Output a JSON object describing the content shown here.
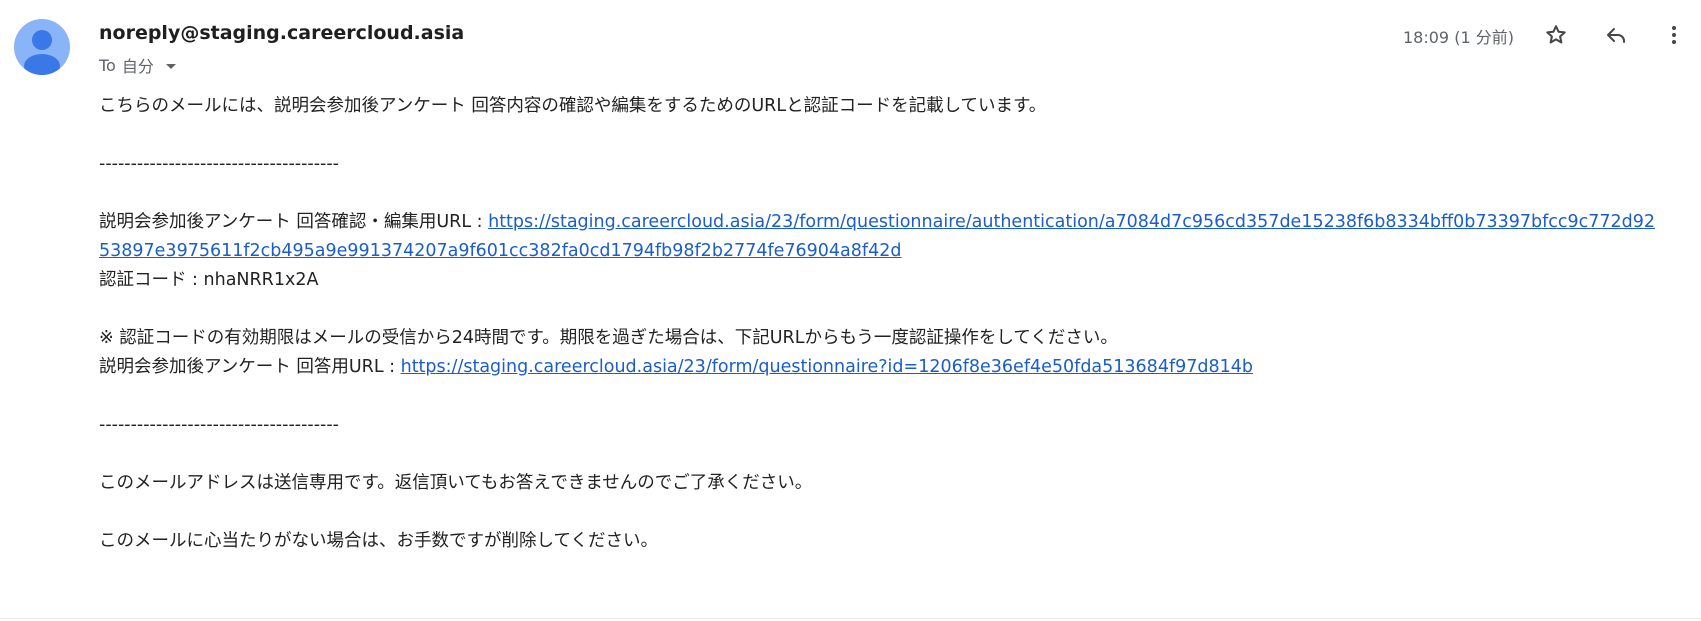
{
  "header": {
    "sender": "noreply@staging.careercloud.asia",
    "recipient_prefix": "To",
    "recipient": "自分",
    "timestamp": "18:09 (1 分前)"
  },
  "icons": {
    "avatar": "person-avatar",
    "star": "star-icon",
    "reply": "reply-icon",
    "more": "more-vert-icon"
  },
  "body": {
    "intro": "こちらのメールには、説明会参加後アンケート 回答内容の確認や編集をするためのURLと認証コードを記載しています。",
    "divider1": "--------------------------------------",
    "edit_url_label": "説明会参加後アンケート 回答確認・編集用URL : ",
    "edit_url": "https://staging.careercloud.asia/23/form/questionnaire/authentication/a7084d7c956cd357de15238f6b8334bff0b73397bfcc9c772d9253897e3975611f2cb495a9e991374207a9f601cc382fa0cd1794fb98f2b2774fe76904a8f42d",
    "auth_code_line": "認証コード : nhaNRR1x2A",
    "note": "※ 認証コードの有効期限はメールの受信から24時間です。期限を過ぎた場合は、下記URLからもう一度認証操作をしてください。",
    "answer_url_label": "説明会参加後アンケート 回答用URL : ",
    "answer_url": "https://staging.careercloud.asia/23/form/questionnaire?id=1206f8e36ef4e50fda513684f97d814b",
    "divider2": "--------------------------------------",
    "noreply_note": "このメールアドレスは送信専用です。返信頂いてもお答えできませんのでご了承ください。",
    "delete_note": "このメールに心当たりがない場合は、お手数ですが削除してください。"
  },
  "colors": {
    "link": "#1a5dcb",
    "avatar_bg": "#8ab4f8",
    "avatar_fg": "#3b78e7"
  }
}
